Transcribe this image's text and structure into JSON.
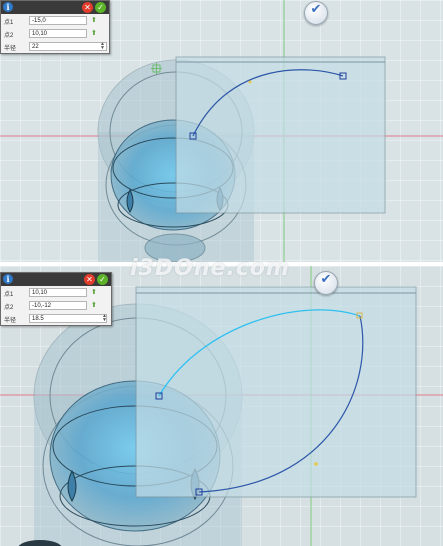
{
  "panels": [
    {
      "dialog": {
        "info_icon": "info-icon",
        "cancel_icon": "close-icon",
        "ok_icon": "check-icon",
        "rows": [
          {
            "label": "点1",
            "value": "-15,0"
          },
          {
            "label": "点2",
            "value": "10,10"
          },
          {
            "label": "半径",
            "value": "22"
          }
        ]
      },
      "confirm_icon": "checkmark-icon"
    },
    {
      "dialog": {
        "info_icon": "info-icon",
        "cancel_icon": "close-icon",
        "ok_icon": "check-icon",
        "rows": [
          {
            "label": "点1",
            "value": "10,10"
          },
          {
            "label": "点2",
            "value": "-10,-12"
          },
          {
            "label": "半径",
            "value": "18.5"
          }
        ]
      },
      "confirm_icon": "checkmark-icon"
    }
  ],
  "watermark": "i3DOne.com",
  "colors": {
    "viewport": "#d9e3e5",
    "sketch_plane": "#c4dde6",
    "arc": "#2d57a8",
    "arc_highlight": "#2ec0f0",
    "axis_red": "#e07a8a",
    "axis_green": "#7ecb7e"
  }
}
